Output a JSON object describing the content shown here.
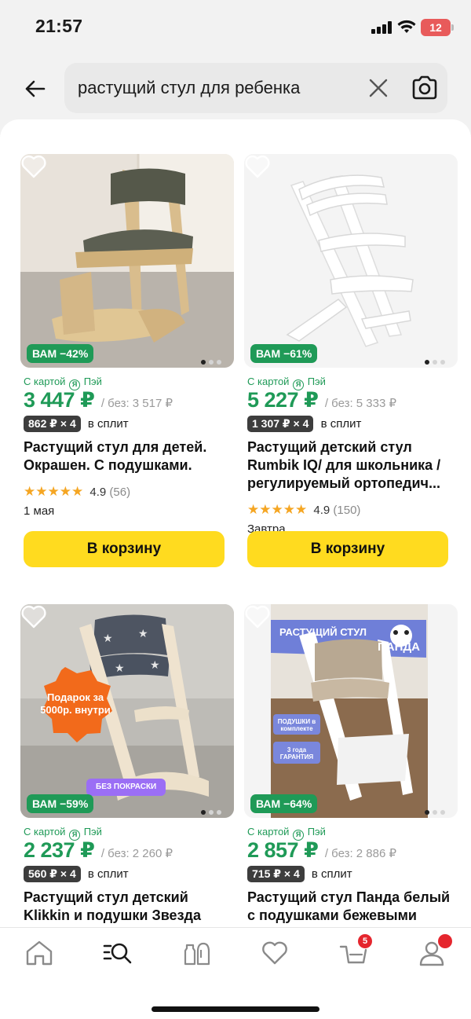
{
  "status_bar": {
    "time": "21:57",
    "battery": "12"
  },
  "search": {
    "query": "растущий стул для ребенка"
  },
  "products": [
    {
      "discount": "ВАМ −42%",
      "card_label_before": "С картой",
      "card_label_after": "Пэй",
      "price": "3 447 ₽",
      "old_price": "/ без: 3 517 ₽",
      "split_amount": "862 ₽ × 4",
      "split_text": "в сплит",
      "title": "Растущий стул для детей. Окрашен. С подушками.",
      "stars": "★★★★★",
      "rating": "4.9",
      "rating_count": "(56)",
      "delivery": "1 мая",
      "cart_label": "В корзину"
    },
    {
      "discount": "ВАМ −61%",
      "card_label_before": "С картой",
      "card_label_after": "Пэй",
      "price": "5 227 ₽",
      "old_price": "/ без: 5 333 ₽",
      "split_amount": "1 307 ₽ × 4",
      "split_text": "в сплит",
      "title": "Растущий детский стул Rumbik IQ/ для школьника / регулируемый ортопедич...",
      "stars": "★★★★★",
      "rating": "4.9",
      "rating_count": "(150)",
      "delivery": "Завтра",
      "cart_label": "В корзину"
    },
    {
      "discount": "ВАМ −59%",
      "card_label_before": "С картой",
      "card_label_after": "Пэй",
      "price": "2 237 ₽",
      "old_price": "/ без: 2 260 ₽",
      "split_amount": "560 ₽ × 4",
      "split_text": "в сплит",
      "title": "Растущий стул детский Klikkin и подушки Звезда",
      "photo_promo": "Подарок за 5000р. внутри",
      "photo_tag": "БЕЗ ПОКРАСКИ"
    },
    {
      "discount": "ВАМ −64%",
      "card_label_before": "С картой",
      "card_label_after": "Пэй",
      "price": "2 857 ₽",
      "old_price": "/ без: 2 886 ₽",
      "split_amount": "715 ₽ × 4",
      "split_text": "в сплит",
      "title": "Растущий стул Панда белый с подушками бежевыми",
      "photo_banner_1": "РАСТУЩИЙ СТУЛ",
      "photo_banner_2": "ПАНДА",
      "photo_tag_1": "ПОДУШКИ в комплекте",
      "photo_tag_2": "3 года ГАРАНТИЯ"
    }
  ],
  "bottom_nav": {
    "cart_badge": "5"
  },
  "colors": {
    "accent_green": "#1f9a57",
    "cart_yellow": "#ffdb1f",
    "badge_red": "#e5262e"
  },
  "icons": [
    "back-arrow-icon",
    "close-icon",
    "camera-search-icon",
    "heart-icon",
    "home-icon",
    "catalog-search-icon",
    "products-icon",
    "favorites-icon",
    "cart-icon",
    "profile-icon"
  ]
}
